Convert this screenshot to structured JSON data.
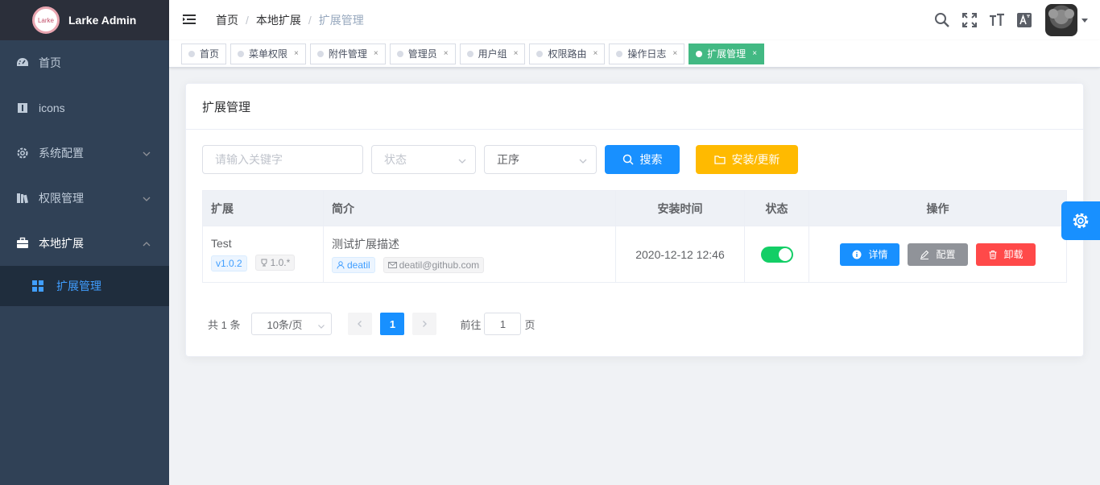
{
  "brand": {
    "logo_text": "Larke",
    "title": "Larke Admin"
  },
  "sidebar": {
    "items": [
      {
        "label": "首页"
      },
      {
        "label": "icons"
      },
      {
        "label": "系统配置"
      },
      {
        "label": "权限管理"
      },
      {
        "label": "本地扩展"
      }
    ],
    "sub_items": [
      {
        "label": "扩展管理"
      }
    ]
  },
  "breadcrumb": [
    "首页",
    "本地扩展",
    "扩展管理"
  ],
  "tags": [
    {
      "label": "首页"
    },
    {
      "label": "菜单权限"
    },
    {
      "label": "附件管理"
    },
    {
      "label": "管理员"
    },
    {
      "label": "用户组"
    },
    {
      "label": "权限路由"
    },
    {
      "label": "操作日志"
    },
    {
      "label": "扩展管理"
    }
  ],
  "tag_close": "×",
  "card": {
    "title": "扩展管理"
  },
  "filters": {
    "keyword_placeholder": "请输入关键字",
    "status_placeholder": "状态",
    "order_value": "正序",
    "search_label": "搜索",
    "install_label": "安装/更新"
  },
  "table": {
    "headers": [
      "扩展",
      "简介",
      "安装时间",
      "状态",
      "操作"
    ],
    "rows": [
      {
        "name": "Test",
        "version": "v1.0.2",
        "adapter": "1.0.*",
        "description": "测试扩展描述",
        "author": "deatil",
        "email": "deatil@github.com",
        "install_time": "2020-12-12 12:46",
        "status_on": true,
        "actions": {
          "detail": "详情",
          "config": "配置",
          "uninstall": "卸载"
        }
      }
    ]
  },
  "pagination": {
    "total_text": "共 1 条",
    "page_size": "10条/页",
    "current_page": "1",
    "goto_prefix": "前往",
    "goto_value": "1",
    "goto_suffix": "页"
  },
  "colors": {
    "sidebar_bg": "#304156",
    "primary": "#1890ff",
    "warning": "#ffba00",
    "info": "#909399",
    "danger": "#ff4949",
    "success": "#13ce66",
    "active_tag": "#42b983"
  }
}
